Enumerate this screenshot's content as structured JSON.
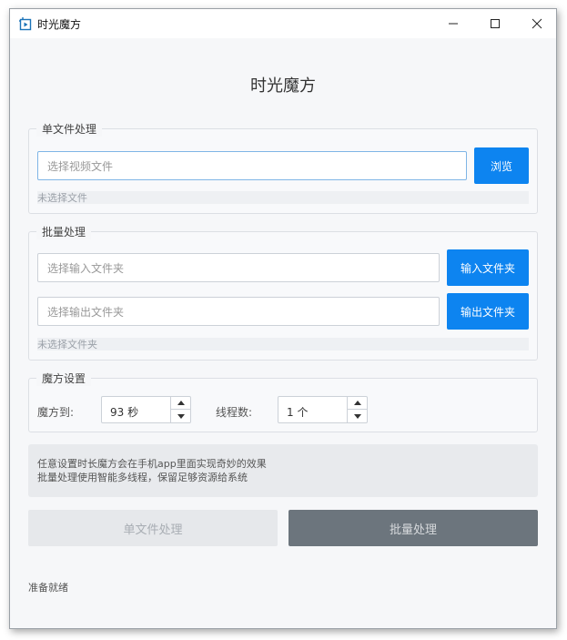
{
  "window": {
    "title": "时光魔方",
    "minimize_icon": "minimize-icon",
    "maximize_icon": "maximize-icon",
    "close_icon": "close-icon"
  },
  "app_title": "时光魔方",
  "single": {
    "legend": "单文件处理",
    "file_placeholder": "选择视频文件",
    "browse_label": "浏览",
    "status": "未选择文件"
  },
  "batch": {
    "legend": "批量处理",
    "input_placeholder": "选择输入文件夹",
    "input_button": "输入文件夹",
    "output_placeholder": "选择输出文件夹",
    "output_button": "输出文件夹",
    "status": "未选择文件夹"
  },
  "settings": {
    "legend": "魔方设置",
    "target_label": "魔方到:",
    "target_value": "93 秒",
    "threads_label": "线程数:",
    "threads_value": "1 个"
  },
  "info": {
    "line1": "任意设置时长魔方会在手机app里面实现奇妙的效果",
    "line2": "批量处理使用智能多线程，保留足够资源给系统"
  },
  "actions": {
    "single_label": "单文件处理",
    "batch_label": "批量处理"
  },
  "status_bar": "准备就绪",
  "colors": {
    "accent": "#0d84f0",
    "batch_button": "#6c757d",
    "background": "#f6f7f9"
  }
}
